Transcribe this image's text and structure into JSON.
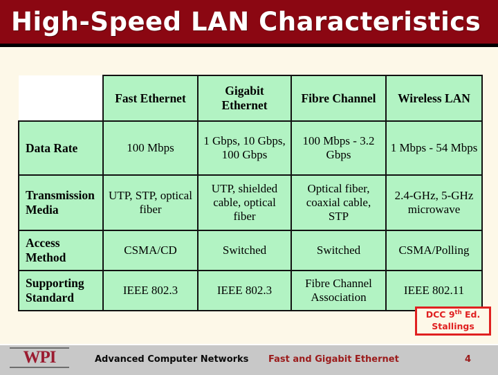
{
  "slide": {
    "title": "High-Speed LAN Characteristics",
    "title_bar_color": "#8B0712",
    "background_color": "#FDF8E8"
  },
  "table": {
    "cell_color": "#B2F3C3",
    "corner_label": "",
    "column_headers": [
      "Fast Ethernet",
      "Gigabit Ethernet",
      "Fibre Channel",
      "Wireless LAN"
    ],
    "rows": [
      {
        "label": "Data Rate",
        "cells": [
          "100 Mbps",
          "1 Gbps, 10 Gbps, 100 Gbps",
          "100 Mbps - 3.2 Gbps",
          "1 Mbps - 54 Mbps"
        ]
      },
      {
        "label": "Transmission Media",
        "cells": [
          "UTP, STP, optical fiber",
          "UTP, shielded cable, optical fiber",
          "Optical fiber, coaxial cable, STP",
          "2.4-GHz, 5-GHz microwave"
        ]
      },
      {
        "label": "Access Method",
        "cells": [
          "CSMA/CD",
          "Switched",
          "Switched",
          "CSMA/Polling"
        ]
      },
      {
        "label": "Supporting Standard",
        "cells": [
          "IEEE 802.3",
          "IEEE 802.3",
          "Fibre Channel Association",
          "IEEE 802.11"
        ]
      }
    ]
  },
  "citation": {
    "line1_prefix": "DCC 9",
    "line1_sup": "th",
    "line1_suffix": " Ed.",
    "line2": "Stallings",
    "color": "#E02020"
  },
  "footer": {
    "logo": "WPI",
    "course": "Advanced Computer Networks",
    "topic": "Fast and Gigabit Ethernet",
    "page_number": "4",
    "bar_color": "#C8C8C8",
    "accent_color": "#9B1B1B"
  }
}
